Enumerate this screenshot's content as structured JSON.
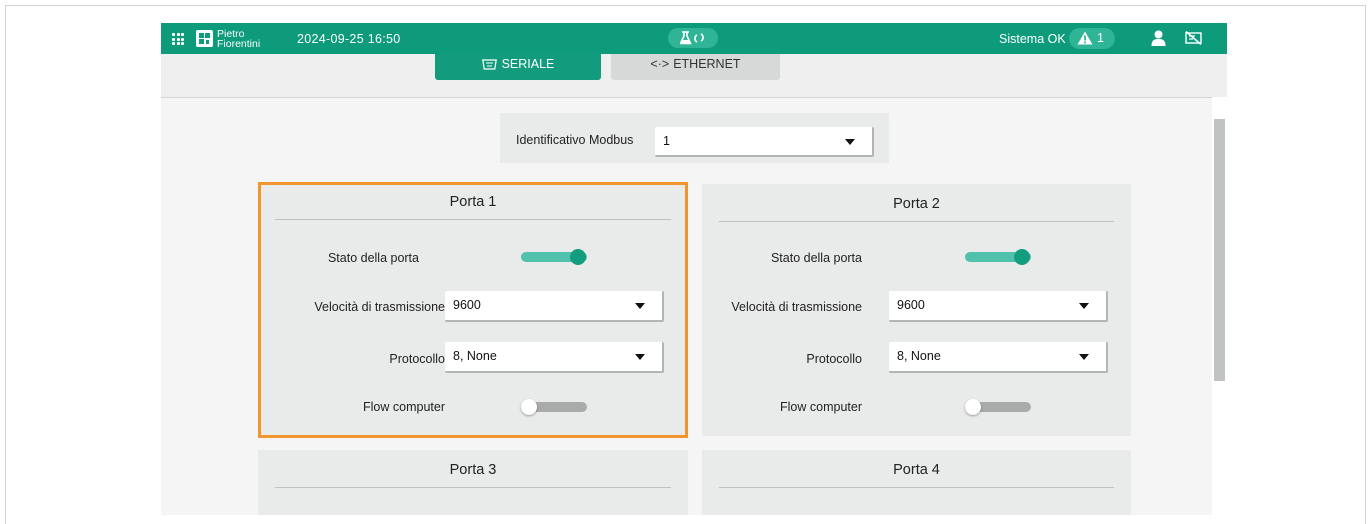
{
  "header": {
    "logo_line1": "Pietro",
    "logo_line2": "Fiorentini",
    "datetime": "2024-09-25 16:50",
    "status_text": "Sistema OK",
    "alarm_count": "1"
  },
  "tabs": [
    {
      "label": "SERIALE",
      "active": true,
      "icon": "serial-port-icon"
    },
    {
      "label": "ETHERNET",
      "active": false,
      "icon": "ethernet-icon"
    }
  ],
  "modbus": {
    "label": "Identificativo Modbus",
    "value": "1"
  },
  "ports": [
    {
      "title": "Porta 1",
      "state_label": "Stato della porta",
      "state_on": true,
      "speed_label": "Velocità di trasmissione",
      "speed_value": "9600",
      "protocol_label": "Protocollo",
      "protocol_value": "8, None",
      "flow_label": "Flow computer",
      "flow_on": false
    },
    {
      "title": "Porta 2",
      "state_label": "Stato della porta",
      "state_on": true,
      "speed_label": "Velocità di trasmissione",
      "speed_value": "9600",
      "protocol_label": "Protocollo",
      "protocol_value": "8, None",
      "flow_label": "Flow computer",
      "flow_on": false
    },
    {
      "title": "Porta 3"
    },
    {
      "title": "Porta 4"
    }
  ],
  "colors": {
    "header_green": "#0d9b7c",
    "toggle_on": "#149c7e",
    "highlight_orange": "#f0962f"
  }
}
